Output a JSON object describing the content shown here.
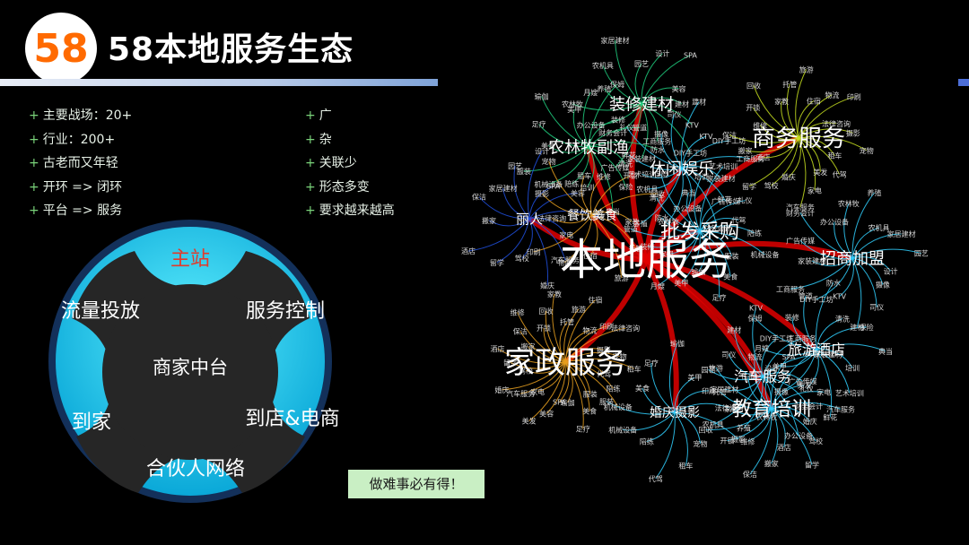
{
  "header": {
    "logo_text": "58",
    "title": "58本地服务生态"
  },
  "left_bullets": [
    "主要战场：20+",
    "行业：200+",
    "古老而又年轻",
    "开环 => 闭环",
    "平台 => 服务"
  ],
  "right_bullets": [
    "广",
    "杂",
    "关联少",
    "形态多变",
    "要求越来越高"
  ],
  "wheel": {
    "main_site": "主站",
    "traffic": "流量投放",
    "service_control": "服务控制",
    "merchant_platform": "商家中台",
    "to_home": "到家",
    "to_store": "到店&电商",
    "partner_network": "合伙人网络"
  },
  "graph": {
    "center": "本地服务",
    "hubs": [
      {
        "label": "装修建材"
      },
      {
        "label": "商务服务"
      },
      {
        "label": "农林牧副渔"
      },
      {
        "label": "休闲娱乐"
      },
      {
        "label": "丽人"
      },
      {
        "label": "餐饮美食"
      },
      {
        "label": "批发采购"
      },
      {
        "label": "招商加盟"
      },
      {
        "label": "家政服务"
      },
      {
        "label": "旅游酒店"
      },
      {
        "label": "汽车服务"
      },
      {
        "label": "教育培训"
      },
      {
        "label": "婚庆摄影"
      }
    ],
    "leaves": [
      "建材",
      "KTV",
      "DIY手工坊",
      "工商服务",
      "家装建材",
      "广告传媒",
      "财务会计",
      "办公设备",
      "农林牧",
      "养殖",
      "农机具",
      "家居建材",
      "园艺",
      "设计",
      "SPA",
      "美容",
      "美发",
      "家电",
      "汽车服务",
      "婚庆",
      "驾校",
      "留学",
      "酒店",
      "搬家",
      "保洁",
      "维修",
      "开锁",
      "回收",
      "家教",
      "托管",
      "旅游",
      "住宿",
      "物流",
      "印刷",
      "法律咨询",
      "摄影",
      "宠物",
      "租车",
      "代驾",
      "陪练",
      "机械设备",
      "服装",
      "美食",
      "足疗",
      "瑜伽",
      "美甲",
      "月嫂",
      "保姆",
      "装修",
      "管道",
      "防水",
      "清洗",
      "保险",
      "典当",
      "培训",
      "艺术培训",
      "鲜花",
      "礼仪",
      "摄像",
      "司仪"
    ],
    "colors": {
      "center_link": "#e00000",
      "home": "#e8a020",
      "business": "#c8e020",
      "education": "#30d0ff",
      "decor": "#20d080",
      "beauty": "#2050e0"
    }
  },
  "motto": "做难事必有得！"
}
